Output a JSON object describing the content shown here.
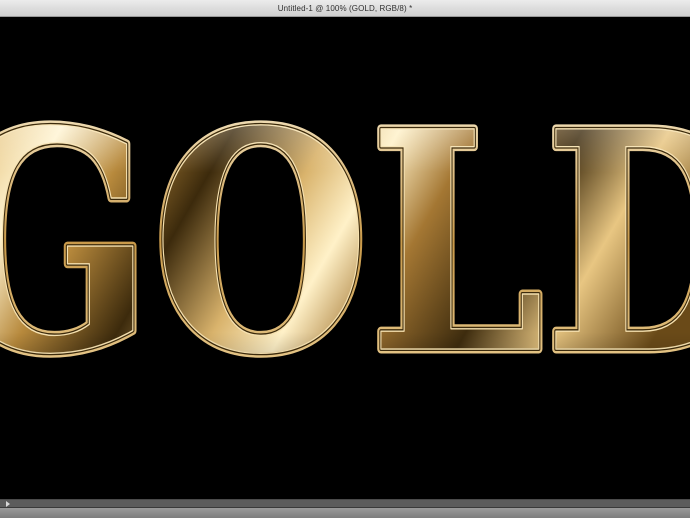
{
  "window": {
    "title": "Untitled-1 @ 100% (GOLD, RGB/8) *"
  },
  "canvas": {
    "layer_text": "GOLD",
    "background_color": "#000000",
    "text_colors": {
      "highlight": "#fff4cf",
      "light": "#e9c98a",
      "mid": "#b98a3e",
      "dark": "#4a3410",
      "shadow": "#1c1406"
    }
  },
  "statusbar": {
    "arrow_icon": "play-triangle-icon"
  }
}
